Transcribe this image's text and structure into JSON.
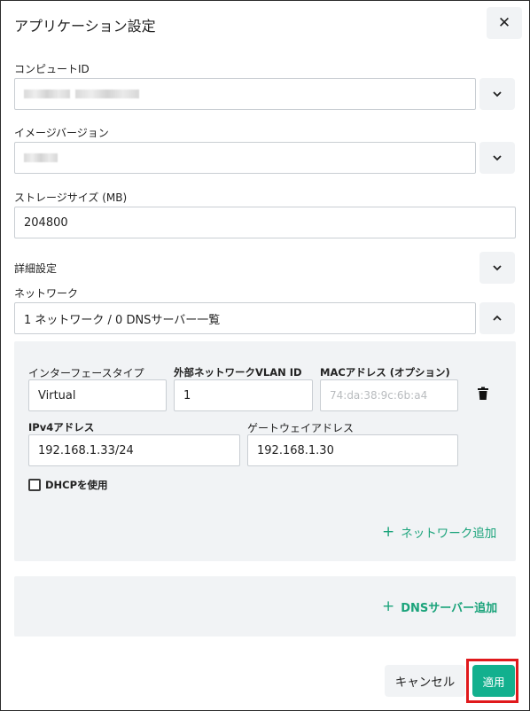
{
  "dialog": {
    "title": "アプリケーション設定"
  },
  "computer_id": {
    "label": "コンピュートID"
  },
  "image_version": {
    "label": "イメージバージョン"
  },
  "storage": {
    "label": "ストレージサイズ (MB)",
    "value": "204800"
  },
  "advanced": {
    "label": "詳細設定"
  },
  "network": {
    "label": "ネットワーク",
    "summary": "1 ネットワーク / 0 DNSサーバー一覧",
    "interface_type_label": "インターフェースタイプ",
    "interface_type_value": "Virtual",
    "vlan_label": "外部ネットワークVLAN ID",
    "vlan_value": "1",
    "mac_label": "MACアドレス (オプション)",
    "mac_placeholder": "74:da:38:9c:6b:a4",
    "ipv4_label": "IPv4アドレス",
    "ipv4_value": "192.168.1.33/24",
    "gateway_label": "ゲートウェイアドレス",
    "gateway_value": "192.168.1.30",
    "dhcp_label": "DHCPを使用",
    "dhcp_checked": false,
    "add_network_label": "ネットワーク追加",
    "add_dns_label": "DNSサーバー追加"
  },
  "footer": {
    "cancel_label": "キャンセル",
    "apply_label": "適用"
  },
  "colors": {
    "accent": "#12b08e",
    "link": "#1aa37a",
    "highlight": "#e0191c",
    "panel": "#f1f3f5"
  },
  "icons": [
    "close-icon",
    "chevron-down-icon",
    "chevron-up-icon",
    "trash-icon",
    "plus-icon"
  ]
}
